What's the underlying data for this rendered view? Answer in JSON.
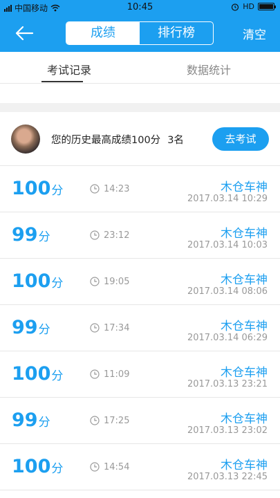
{
  "status_bar": {
    "carrier": "中国移动",
    "time": "10:45",
    "indicators": "HD"
  },
  "nav": {
    "back_icon": "back-arrow-icon",
    "segments": [
      "成绩",
      "排行榜"
    ],
    "active_segment": 0,
    "clear_label": "清空"
  },
  "colors": {
    "primary": "#1c9ff0",
    "text_gray": "#999999"
  },
  "tabs": [
    "考试记录",
    "数据统计"
  ],
  "best": {
    "text": "您的历史最高成绩100分",
    "rank": "3名",
    "button": "去考试"
  },
  "records": [
    {
      "score": "100",
      "unit": "分",
      "duration": "14:23",
      "name": "木仓车神",
      "date": "2017.03.14  10:29"
    },
    {
      "score": "99",
      "unit": "分",
      "duration": "23:12",
      "name": "木仓车神",
      "date": "2017.03.14  10:03"
    },
    {
      "score": "100",
      "unit": "分",
      "duration": "19:05",
      "name": "木仓车神",
      "date": "2017.03.14  08:06"
    },
    {
      "score": "99",
      "unit": "分",
      "duration": "17:34",
      "name": "木仓车神",
      "date": "2017.03.14  06:29"
    },
    {
      "score": "100",
      "unit": "分",
      "duration": "11:09",
      "name": "木仓车神",
      "date": "2017.03.13  23:21"
    },
    {
      "score": "99",
      "unit": "分",
      "duration": "17:25",
      "name": "木仓车神",
      "date": "2017.03.13  23:02"
    },
    {
      "score": "100",
      "unit": "分",
      "duration": "14:54",
      "name": "木仓车神",
      "date": "2017.03.13  22:45"
    }
  ]
}
